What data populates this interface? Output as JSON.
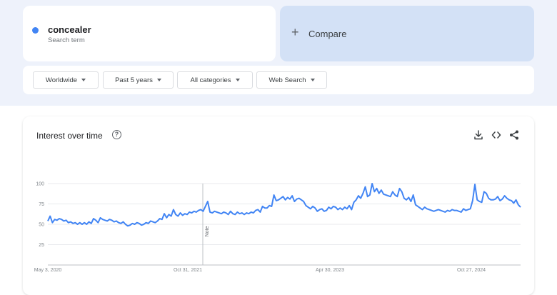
{
  "search_term": {
    "name": "concealer",
    "label": "Search term",
    "color": "#4285f4"
  },
  "compare": {
    "label": "Compare",
    "icon": "plus-icon"
  },
  "filters": [
    {
      "label": "Worldwide"
    },
    {
      "label": "Past 5 years"
    },
    {
      "label": "All categories"
    },
    {
      "label": "Web Search"
    }
  ],
  "chart": {
    "title": "Interest over time",
    "help_icon": "help-icon",
    "tools": [
      "download-icon",
      "embed-icon",
      "share-icon"
    ],
    "note_label": "Note"
  },
  "chart_data": {
    "type": "line",
    "line_color": "#4285f4",
    "y_ticks": [
      "100",
      "75",
      "50",
      "25"
    ],
    "ylim": [
      0,
      100
    ],
    "x_tick_labels": [
      "May 3, 2020",
      "Oct 31, 2021",
      "Apr 30, 2023",
      "Oct 27, 2024"
    ],
    "grid": true,
    "series": [
      {
        "values": [
          54,
          60,
          52,
          56,
          55,
          57,
          56,
          54,
          55,
          52,
          53,
          51,
          52,
          50,
          52,
          50,
          52,
          50,
          53,
          51,
          57,
          55,
          52,
          58,
          56,
          55,
          54,
          56,
          55,
          53,
          54,
          52,
          51,
          53,
          50,
          48,
          49,
          51,
          50,
          52,
          51,
          49,
          50,
          52,
          51,
          54,
          53,
          52,
          54,
          57,
          56,
          63,
          58,
          62,
          60,
          68,
          62,
          60,
          64,
          61,
          63,
          62,
          65,
          64,
          66,
          65,
          67,
          68,
          66,
          72,
          78,
          65,
          64,
          66,
          65,
          64,
          63,
          65,
          64,
          62,
          66,
          63,
          62,
          65,
          63,
          64,
          62,
          64,
          63,
          65,
          64,
          67,
          68,
          65,
          72,
          70,
          70,
          73,
          72,
          86,
          79,
          80,
          82,
          84,
          80,
          83,
          81,
          85,
          78,
          81,
          82,
          80,
          78,
          73,
          71,
          69,
          72,
          70,
          66,
          68,
          69,
          66,
          67,
          71,
          69,
          72,
          71,
          68,
          70,
          68,
          71,
          69,
          73,
          68,
          77,
          80,
          85,
          82,
          88,
          96,
          84,
          86,
          100,
          90,
          94,
          88,
          92,
          87,
          86,
          85,
          84,
          90,
          86,
          84,
          94,
          90,
          82,
          80,
          83,
          78,
          86,
          74,
          72,
          70,
          68,
          71,
          69,
          68,
          67,
          66,
          67,
          68,
          67,
          66,
          65,
          67,
          66,
          68,
          67,
          67,
          66,
          65,
          69,
          67,
          68,
          69,
          79,
          99,
          80,
          78,
          77,
          90,
          88,
          82,
          80,
          80,
          81,
          84,
          79,
          81,
          85,
          82,
          80,
          79,
          76,
          80,
          74,
          71
        ]
      }
    ]
  }
}
